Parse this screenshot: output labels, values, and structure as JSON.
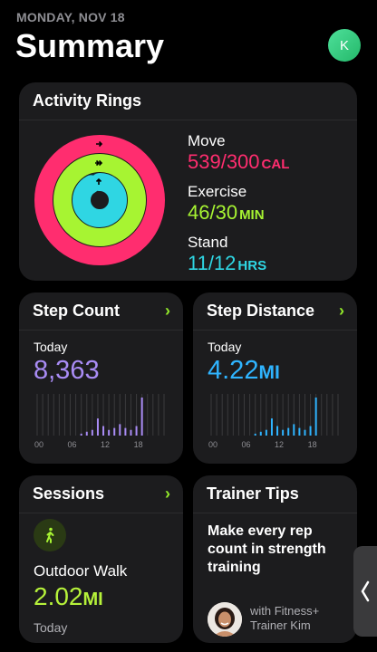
{
  "header": {
    "date": "MONDAY, NOV 18",
    "title": "Summary",
    "avatar_initial": "K"
  },
  "activity": {
    "title": "Activity Rings",
    "move": {
      "label": "Move",
      "value": "539/300",
      "unit": "CAL",
      "color": "#ff2d6f",
      "progress": 1.8
    },
    "exercise": {
      "label": "Exercise",
      "value": "46/30",
      "unit": "MIN",
      "color": "#a7f432",
      "progress": 1.53
    },
    "stand": {
      "label": "Stand",
      "value": "11/12",
      "unit": "HRS",
      "color": "#2fd6e3",
      "progress": 0.92
    }
  },
  "steps": {
    "title": "Step Count",
    "today_label": "Today",
    "value": "8,363",
    "color": "#a98cf5",
    "ticks": [
      "00",
      "06",
      "12",
      "18"
    ],
    "bars": [
      0,
      0,
      0,
      0,
      0,
      0,
      0,
      0,
      0.05,
      0.1,
      0.15,
      0.45,
      0.25,
      0.15,
      0.2,
      0.3,
      0.2,
      0.15,
      0.25,
      1.0,
      0,
      0,
      0,
      0
    ]
  },
  "distance": {
    "title": "Step Distance",
    "today_label": "Today",
    "value": "4.22",
    "unit": "MI",
    "color": "#2fb4ff",
    "ticks": [
      "00",
      "06",
      "12",
      "18"
    ],
    "bars": [
      0,
      0,
      0,
      0,
      0,
      0,
      0,
      0,
      0.05,
      0.1,
      0.15,
      0.45,
      0.25,
      0.15,
      0.2,
      0.3,
      0.2,
      0.15,
      0.25,
      1.0,
      0,
      0,
      0,
      0
    ]
  },
  "sessions": {
    "title": "Sessions",
    "name": "Outdoor Walk",
    "value": "2.02",
    "unit": "MI",
    "day": "Today"
  },
  "tips": {
    "title": "Trainer Tips",
    "text": "Make every rep count in strength training",
    "trainer_line1": "with Fitness+",
    "trainer_line2": "Trainer Kim"
  }
}
